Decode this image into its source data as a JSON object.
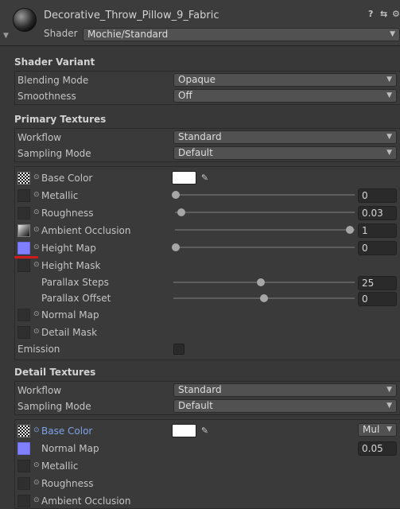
{
  "header": {
    "title": "Decorative_Throw_Pillow_9_Fabric",
    "shader_label": "Shader",
    "shader_value": "Mochie/Standard",
    "icons": [
      "help-icon",
      "preset-icon",
      "settings-icon"
    ]
  },
  "shader_variant": {
    "title": "Shader Variant",
    "rows": [
      {
        "label": "Blending Mode",
        "value": "Opaque"
      },
      {
        "label": "Smoothness",
        "value": "Off"
      }
    ]
  },
  "primary_textures": {
    "title": "Primary Textures",
    "rows": [
      {
        "label": "Workflow",
        "value": "Standard"
      },
      {
        "label": "Sampling Mode",
        "value": "Default"
      }
    ],
    "props": [
      {
        "label": "Base Color"
      },
      {
        "label": "Metallic",
        "value": "0",
        "level": 0.0
      },
      {
        "label": "Roughness",
        "value": "0.03",
        "level": 0.03
      },
      {
        "label": "Ambient Occlusion",
        "value": "1",
        "level": 1.0
      },
      {
        "label": "Height Map",
        "value": "0",
        "level": 0.0
      },
      {
        "label": "Height Mask"
      },
      {
        "label": "Parallax Steps",
        "value": "25",
        "level": 0.5
      },
      {
        "label": "Parallax Offset",
        "value": "0",
        "level": 0.5
      },
      {
        "label": "Normal Map"
      },
      {
        "label": "Detail Mask"
      },
      {
        "label": "Emission"
      }
    ]
  },
  "detail_textures": {
    "title": "Detail Textures",
    "rows": [
      {
        "label": "Workflow",
        "value": "Standard"
      },
      {
        "label": "Sampling Mode",
        "value": "Default"
      }
    ],
    "props": [
      {
        "label": "Base Color",
        "blend": "Mul"
      },
      {
        "label": "Normal Map",
        "value": "0.05"
      },
      {
        "label": "Metallic"
      },
      {
        "label": "Roughness"
      },
      {
        "label": "Ambient Occlusion"
      }
    ]
  },
  "colors": {
    "background": "#383838",
    "accent_label": "#7ea2e6",
    "highlight_underline": "#d01b1b",
    "height_map_swatch": "#8080ff"
  }
}
